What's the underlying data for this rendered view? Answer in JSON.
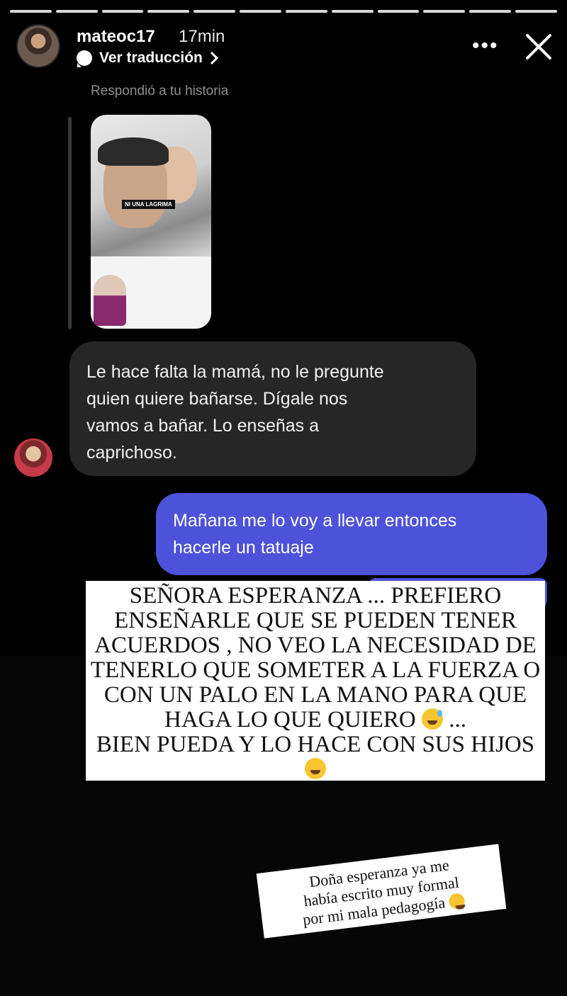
{
  "header": {
    "username": "mateoc17",
    "time": "17min",
    "translate": "Ver traducción",
    "more_icon": "more-icon",
    "close_icon": "close-icon"
  },
  "story_progress": {
    "segments": 12,
    "viewed": 12
  },
  "conversation": {
    "replied_label": "Respondió a tu historia",
    "story_tag": "NI UNA LAGRIMA",
    "incoming_message": "Le hace falta la mamá, no le pregunte quien quiere bañarse. Dígale nos vamos a bañar. Lo enseñas a caprichoso.",
    "incoming_lines": [
      "Le hace falta la mamá, no le pregunte",
      "quien quiere bañarse. Dígale nos",
      "vamos a bañar. Lo enseñas a",
      "caprichoso."
    ],
    "outgoing_lines": [
      "Mañana me lo voy a llevar entonces",
      "hacerle un tatuaje"
    ]
  },
  "sticker_main": {
    "lines": [
      "SEÑORA ESPERANZA ... PREFIERO",
      "ENSEÑARLE QUE SE PUEDEN TENER",
      "ACUERDOS , NO VEO LA NECESIDAD DE",
      "TENERLO QUE SOMETER A LA FUERZA O",
      "CON UN PALO EN LA MANO PARA QUE",
      "HAGA LO QUE QUIERO",
      "...",
      "BIEN PUEDA Y LO HACE CON SUS HIJOS"
    ],
    "emoji_1": "sweat-smile-emoji",
    "emoji_2": "kissing-emoji"
  },
  "sticker_small": {
    "lines": [
      "Doña esperanza ya me",
      "había escrito muy formal",
      "por mi mala pedagogía"
    ],
    "emoji": "laughing-tears-emoji"
  },
  "colors": {
    "outgoing_bubble": "#4c52d9",
    "incoming_bubble": "#262626",
    "background": "#000000"
  }
}
